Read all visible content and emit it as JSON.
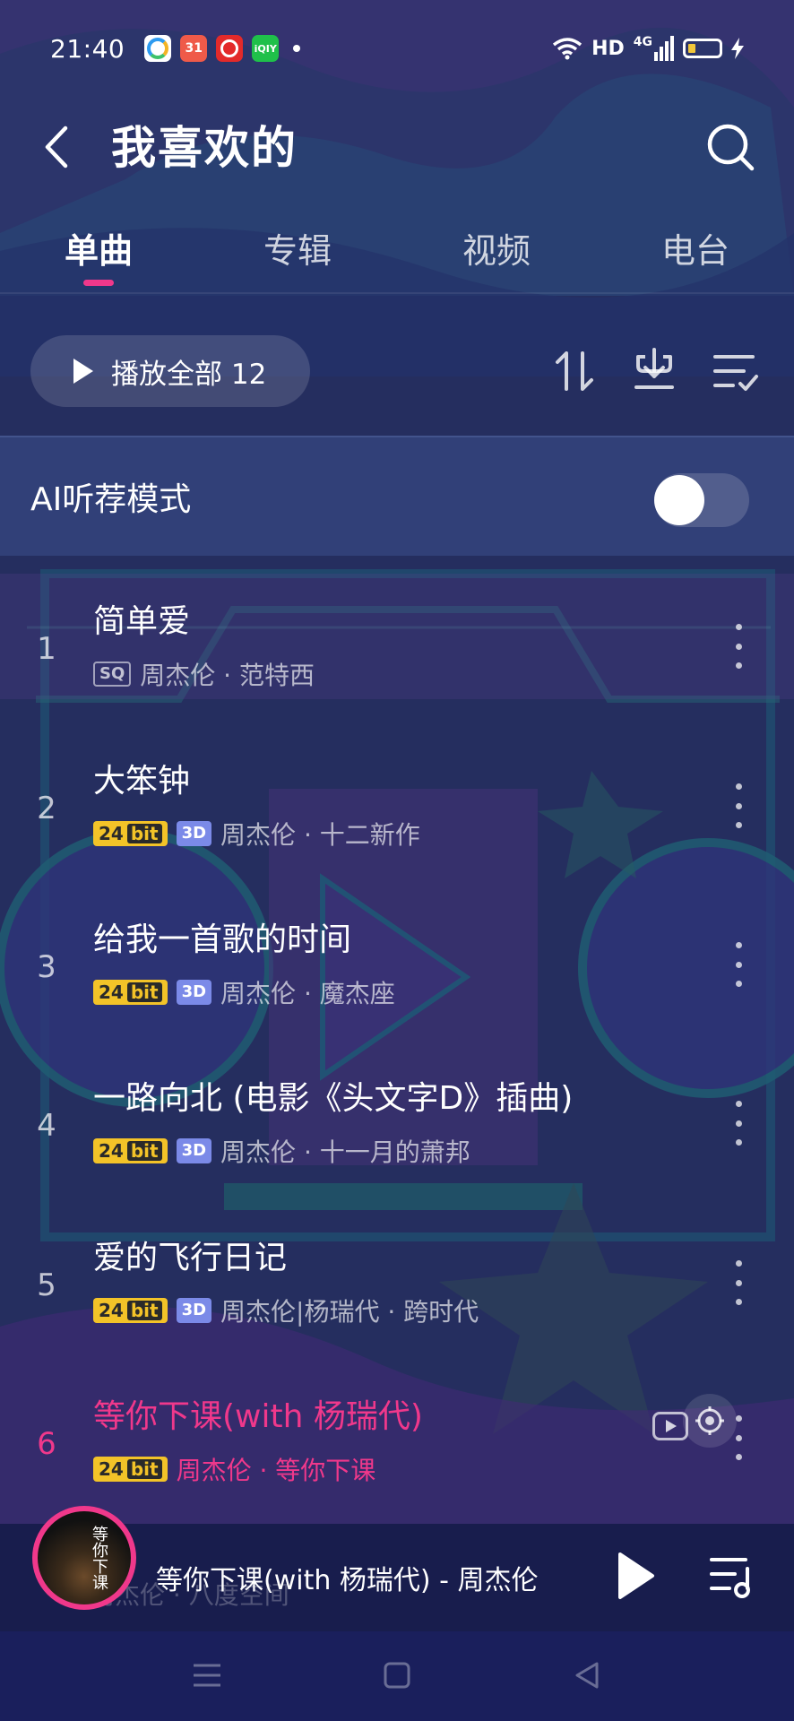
{
  "status_bar": {
    "time": "21:40",
    "notification_icons": [
      "baidu-app-icon",
      "calendar-icon",
      "netease-music-icon",
      "iqiyi-icon"
    ],
    "calendar_day": "31",
    "iqiyi_text": "iQIY",
    "network_label": "HD",
    "cell_label": "4G",
    "battery_level": 0.15
  },
  "header": {
    "title": "我喜欢的"
  },
  "tabs": [
    {
      "label": "单曲",
      "active": true
    },
    {
      "label": "专辑",
      "active": false
    },
    {
      "label": "视频",
      "active": false
    },
    {
      "label": "电台",
      "active": false
    }
  ],
  "actions": {
    "play_all_label": "播放全部 12",
    "icons": [
      "sort-icon",
      "download-icon",
      "multi-select-icon"
    ]
  },
  "ai_mode": {
    "label": "AI听荐模式",
    "enabled": false
  },
  "songs": [
    {
      "index": "1",
      "title": "简单爱",
      "artist": "周杰伦 · 范特西",
      "badges": [
        "SQ"
      ]
    },
    {
      "index": "2",
      "title": "大笨钟",
      "artist": "周杰伦 · 十二新作",
      "badges": [
        "24bit",
        "3D"
      ]
    },
    {
      "index": "3",
      "title": "给我一首歌的时间",
      "artist": "周杰伦 · 魔杰座",
      "badges": [
        "24bit",
        "3D"
      ]
    },
    {
      "index": "4",
      "title": "一路向北 (电影《头文字D》插曲)",
      "artist": "周杰伦 · 十一月的萧邦",
      "badges": [
        "24bit",
        "3D"
      ]
    },
    {
      "index": "5",
      "title": "爱的飞行日记",
      "artist": "周杰伦|杨瑞代 · 跨时代",
      "badges": [
        "24bit",
        "3D"
      ]
    },
    {
      "index": "6",
      "title": "等你下课(with 杨瑞代)",
      "artist": "周杰伦 · 等你下课",
      "badges": [
        "24bit"
      ],
      "playing": true
    }
  ],
  "badge_text": {
    "sq": "SQ",
    "bit_num": "24",
    "bit_word": "bit",
    "d3": "3D"
  },
  "mini_player": {
    "now_playing": "等你下课(with 杨瑞代) - 周杰伦",
    "cover_text": "等你下课",
    "peek_text": "周杰伦 · 八度空间"
  },
  "colors": {
    "accent": "#f0388b",
    "bit_badge": "#f3c328",
    "three_d_badge": "#7b8ae8"
  }
}
